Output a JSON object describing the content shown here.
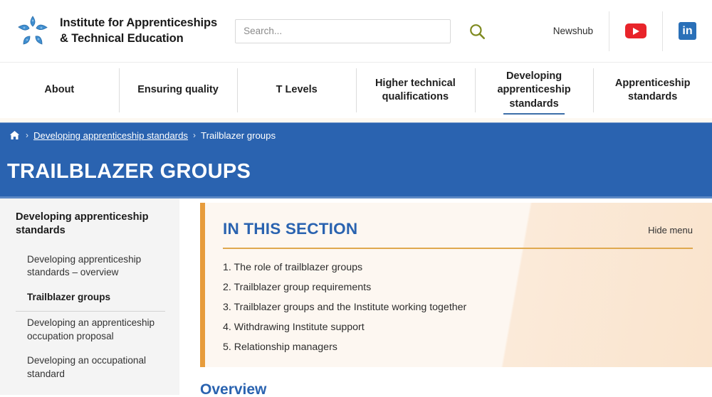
{
  "header": {
    "logo_icon": "ifate-flower-logo",
    "brand_name": "Institute for Apprenticeships\n& Technical Education",
    "search": {
      "placeholder": "Search...",
      "value": "",
      "button_icon": "search-icon"
    },
    "newshub_label": "Newshub",
    "youtube_icon": "youtube-icon",
    "linkedin_icon": "linkedin-icon",
    "linkedin_label": "in"
  },
  "nav": {
    "items": [
      {
        "label": "About",
        "active": false
      },
      {
        "label": "Ensuring quality",
        "active": false
      },
      {
        "label": "T Levels",
        "active": false
      },
      {
        "label": "Higher technical\nqualifications",
        "active": false
      },
      {
        "label": "Developing\napprenticeship\nstandards",
        "active": true
      },
      {
        "label": "Apprenticeship\nstandards",
        "active": false
      }
    ]
  },
  "breadcrumb": {
    "home_icon": "home-icon",
    "separator": "›",
    "items": [
      {
        "label": "Developing apprenticeship standards",
        "current": false
      },
      {
        "label": "Trailblazer groups",
        "current": true
      }
    ]
  },
  "banner": {
    "title": "TRAILBLAZER GROUPS"
  },
  "sidebar": {
    "title": "Developing apprenticeship standards",
    "items": [
      {
        "label": "Developing apprenticeship standards – overview",
        "active": false
      },
      {
        "label": "Trailblazer groups",
        "active": true
      },
      {
        "label": "Developing an apprenticeship occupation proposal",
        "active": false
      },
      {
        "label": "Developing an occupational standard",
        "active": false
      }
    ]
  },
  "section_box": {
    "title": "IN THIS SECTION",
    "hide_menu_label": "Hide menu",
    "accent_color": "#e79c3c",
    "rule_color": "#e0a94f",
    "title_color": "#2a63b0",
    "items": [
      "1. The role of trailblazer groups",
      "2. Trailblazer group requirements",
      "3. Trailblazer groups and the Institute working together",
      "4. Withdrawing Institute support",
      "5. Relationship managers"
    ]
  },
  "main": {
    "overview_heading": "Overview"
  },
  "colors": {
    "brand_blue": "#2a63b0",
    "accent_orange": "#e79c3c",
    "search_olive": "#7f8a20",
    "youtube_red": "#e8242a",
    "linkedin_blue": "#2a70b8"
  }
}
